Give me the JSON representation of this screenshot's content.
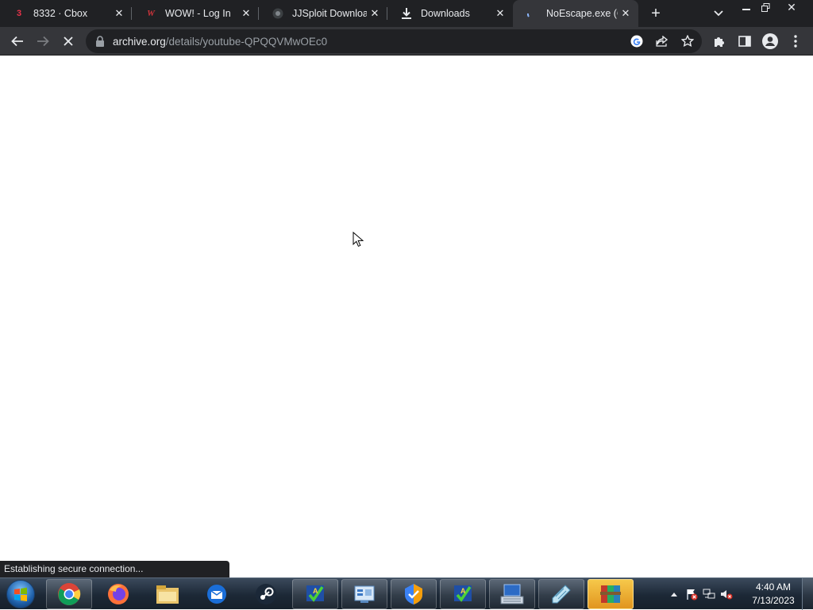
{
  "browser": {
    "tabs": [
      {
        "title": "8332 · Cbox",
        "favicon_text": "3",
        "favicon_color": "#e8334a",
        "icon": "cbox-icon"
      },
      {
        "title": "WOW! - Log In",
        "favicon_text": "W",
        "favicon_color": "#d1343b",
        "icon": "wow-icon"
      },
      {
        "title": "JJSploit Downloac",
        "favicon_text": "",
        "favicon_color": "#5f6368",
        "icon": "jjsploit-icon"
      },
      {
        "title": "Downloads",
        "favicon_text": "",
        "favicon_color": "#e8eaed",
        "icon": "download-icon"
      },
      {
        "title": "NoEscape.exe (Cr",
        "favicon_text": "",
        "favicon_color": "#8ab4f8",
        "icon": "loading-spinner-icon"
      }
    ],
    "url_host": "archive.org",
    "url_path": "/details/youtube-QPQQVMwOEc0",
    "status_text": "Establishing secure connection..."
  },
  "taskbar": {
    "apps": [
      "chrome-icon",
      "firefox-icon",
      "file-explorer-icon",
      "thunderbird-icon",
      "steam-icon",
      "checker-app-icon",
      "control-panel-icon",
      "security-shield-icon",
      "checker-app-icon-2",
      "keyboard-app-icon",
      "notepad-icon",
      "winrar-icon"
    ],
    "clock_time": "4:40 AM",
    "clock_date": "7/13/2023"
  },
  "colors": {
    "tabstrip": "#202124",
    "toolbar": "#35363a",
    "accent": "#8ab4f8"
  }
}
